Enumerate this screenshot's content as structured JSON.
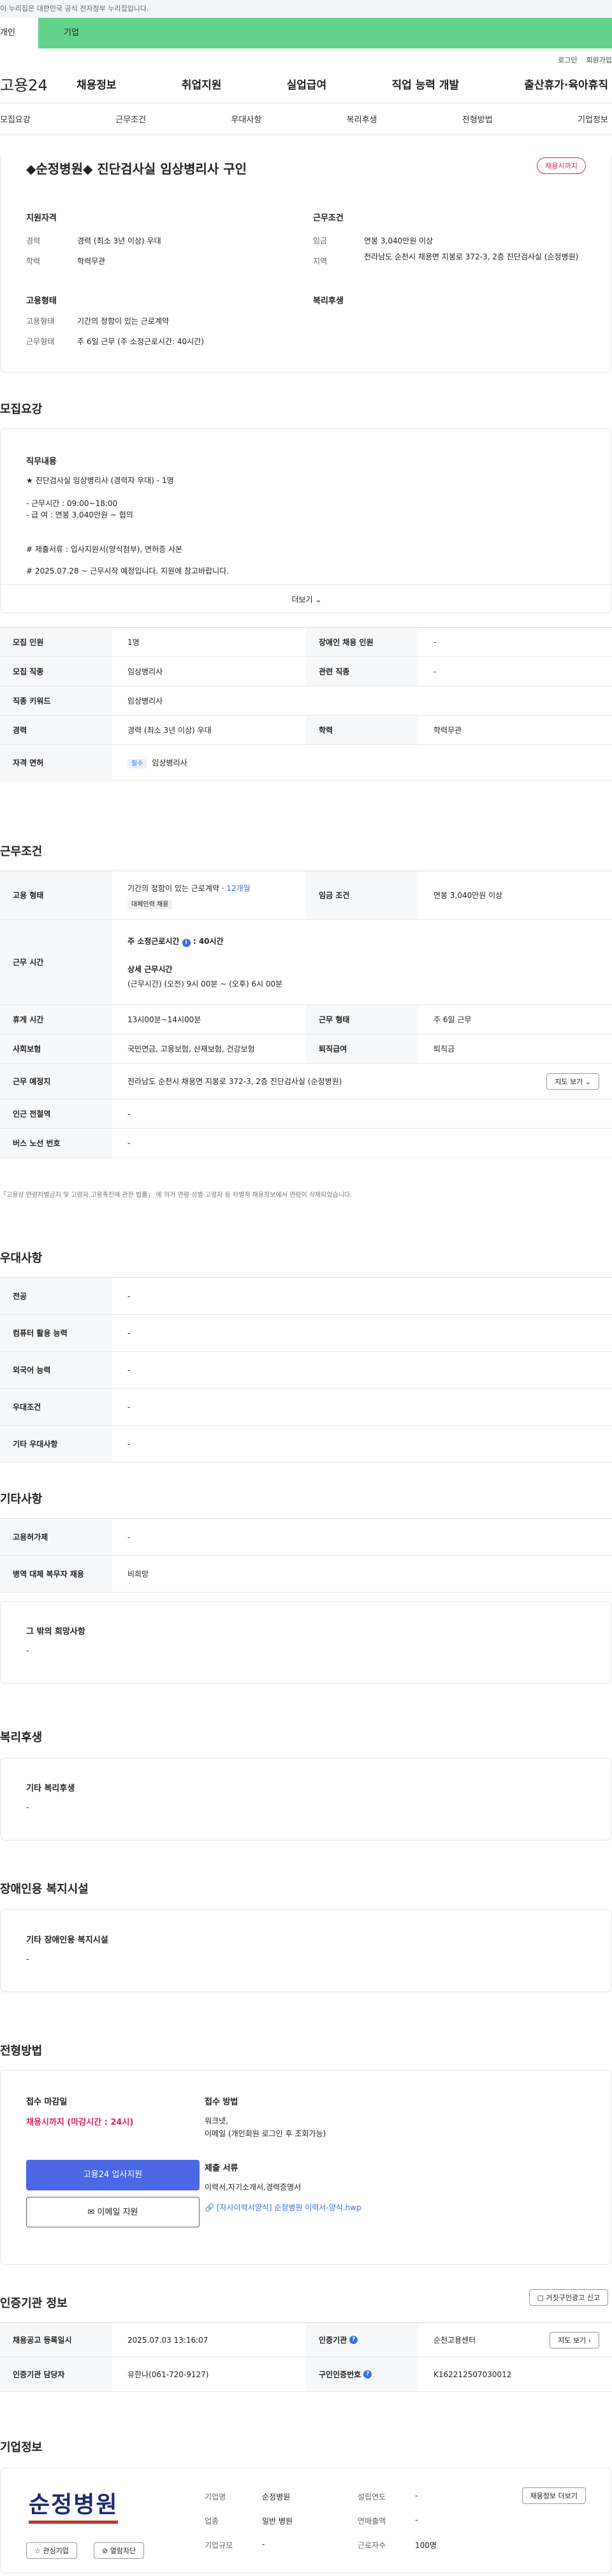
{
  "gov_banner": "이 누리집은 대한민국 공식 전자정부 누리집입니다.",
  "tab1": "개인",
  "tab2": "기업",
  "util": [
    "로그인",
    "회원가입"
  ],
  "logo": "고용24",
  "gnb": [
    "채용정보",
    "취업지원",
    "실업급여",
    "직업 능력 개발",
    "출산휴가·육아휴직"
  ],
  "anchors": [
    "모집요강",
    "근무조건",
    "우대사항",
    "복리후생",
    "전형방법",
    "기업정보"
  ],
  "title": "◆순정병원◆ 진단검사실 임상병리사 구인",
  "closing_badge": "채용시까지",
  "summary": {
    "qual_h": "지원자격",
    "career_l": "경력",
    "career_v": "경력 (최소 3년 이상) 우대",
    "edu_l": "학력",
    "edu_v": "학력무관",
    "cond_h": "근무조건",
    "wage_l": "임금",
    "wage_v": "연봉 3,040만원 이상",
    "loc_l": "지역",
    "loc_v": "전라남도 순천시 채용면 지봉로 372-3, 2층 진단검사실 (순정병원)",
    "emp_h": "고용형태",
    "type_l": "고용형태",
    "type_v": "기간의 정함이 있는 근로계약",
    "hours_l": "근무형태",
    "hours_v": "주 6일 근무 (주 소정근로시간: 40시간)",
    "welfare_h": "복리후생"
  },
  "recruit_h": "모집요강",
  "job_h": "직무내용",
  "job_lines": [
    "★ 진단검사실 임상병리사 (경력자 우대) - 1명",
    "- 근무시간 : 09:00~18:00",
    "- 급      여 : 연봉 3,040만원 ~ 협의",
    "# 제출서류 : 입사지원서(양식첨부), 면허증 사본",
    "# 2025.07.28 ~ 근무시작 예정입니다. 지원에 참고바랍니다."
  ],
  "more": "더보기",
  "recruit_rows": [
    [
      "모집 인원",
      "1명",
      "장애인 채용 인원",
      "-"
    ],
    [
      "모집 직종",
      "임상병리사",
      "관련 직종",
      "-"
    ],
    [
      "직종 키워드",
      "임상병리사",
      "",
      ""
    ],
    [
      "경력",
      "경력 (최소 3년 이상) 우대",
      "학력",
      "학력무관"
    ]
  ],
  "license_l": "자격 면허",
  "license_tag": "필수",
  "license_v": "임상병리사",
  "cond_sec_h": "근무조건",
  "cond": {
    "type_l": "고용 형태",
    "type_v": "기간의 정함이 있는 근로계약 · ",
    "type_months": "12개월",
    "type_tag": "대체인력 채용",
    "wage_l": "임금 조건",
    "wage_v": "연봉 3,040만원 이상",
    "time_l": "근무 시간",
    "time_main": "주 소정근로시간",
    "time_hours": "40시간",
    "time_detail_h": "상세 근무시간",
    "time_detail": "(근무시간) (오전) 9시 00분 ~ (오후) 6시 00분",
    "break_l": "휴게 시간",
    "break_v": "13시00분~14시00분",
    "shift_l": "근무 형태",
    "shift_v": "주 6일 근무",
    "ins_l": "사회보험",
    "ins_v": "국민연금, 고용보험, 산재보험, 건강보험",
    "ret_l": "퇴직급여",
    "ret_v": "퇴직금",
    "place_l": "근무 예정지",
    "place_v": "전라남도 순천시 채용면 지봉로 372-3, 2층 진단검사실 (순정병원)",
    "map_btn": "지도 보기",
    "sub_l": "인근 전철역",
    "sub_v": "-",
    "bus_l": "버스 노선 번호",
    "bus_v": "-",
    "note": "「고용상 연령차별금지 및 고령자 고용촉진에 관한 법률」 에 의거 연령·성별·고령자 등 차별적 채용정보에서 연령이 삭제되었습니다."
  },
  "pref_h": "우대사항",
  "pref_rows": [
    [
      "전공",
      "-"
    ],
    [
      "컴퓨터 활용 능력",
      "-"
    ],
    [
      "외국어 능력",
      "-"
    ],
    [
      "우대조건",
      "-"
    ],
    [
      "기타 우대사항",
      "-"
    ]
  ],
  "etc_h": "기타사항",
  "etc_rows": [
    [
      "고용허가제",
      "-"
    ],
    [
      "병역 대체 복무자 채용",
      "비희망"
    ]
  ],
  "etc_box_h": "그 밖의 희망사항",
  "etc_box_v": "-",
  "welfare_h": "복리후생",
  "welfare_box_h": "기타 복리후생",
  "welfare_box_v": "-",
  "disab_h": "장애인용 복지시설",
  "disab_box_h": "기타 장애인용 복지시설",
  "disab_box_v": "-",
  "sel_h": "전형방법",
  "sel": {
    "deadline_h": "접수 마감일",
    "deadline_v": "채용시까지 (마감시간 : 24시)",
    "apply_btn": "고용24 입사지원",
    "email_btn": "이메일 지원",
    "method_h": "접수 방법",
    "method_v1": "워크넷,",
    "method_v2": "이메일 (개인회원 로그인 후 조회가능)",
    "docs_h": "제출 서류",
    "docs_v": "이력서,자기소개서,경력증명서",
    "file": "[자사이력서양식] 순정병원 이력서-양식.hwp"
  },
  "cert_h": "인증기관 정보",
  "report_btn": "거짓구인광고 신고",
  "cert": {
    "reg_l": "채용공고 등록일시",
    "reg_v": "2025.07.03 13:16:07",
    "org_l": "인증기관",
    "org_v": "순천고용센터",
    "map_btn": "지도 보기",
    "mgr_l": "인증기관 담당자",
    "mgr_v": "유한나(061-720-9127)",
    "no_l": "구인인증번호",
    "no_v": "K162212507030012"
  },
  "corp_h": "기업정보",
  "corp": {
    "logo": "순정병원",
    "interest": "관심기업",
    "block": "열람차단",
    "name_l": "기업명",
    "name_v": "순정병원",
    "ind_l": "업종",
    "ind_v": "일반 병원",
    "size_l": "기업규모",
    "size_v": "-",
    "est_l": "설립연도",
    "est_v": "-",
    "sales_l": "연매출액",
    "sales_v": "-",
    "emp_l": "근로자수",
    "emp_v": "100명",
    "more_btn": "채용정보 더보기"
  }
}
